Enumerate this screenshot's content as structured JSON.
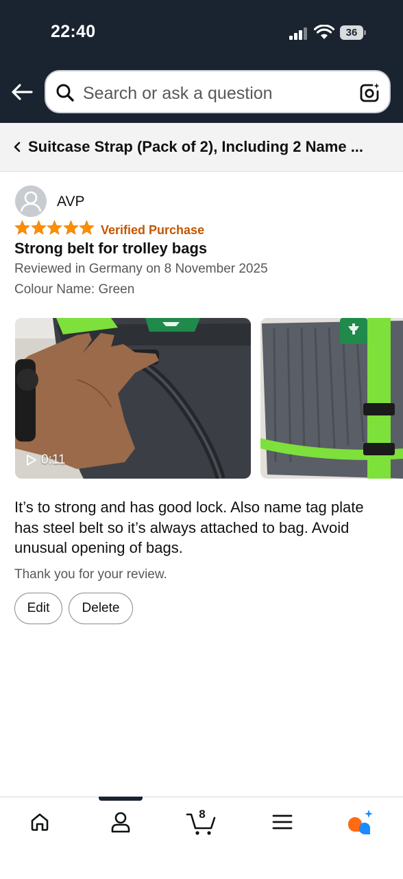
{
  "status_bar": {
    "time": "22:40",
    "battery": "36"
  },
  "search": {
    "placeholder": "Search or ask a question"
  },
  "breadcrumb": {
    "title": "Suitcase Strap (Pack of 2), Including 2 Name ..."
  },
  "review": {
    "reviewer": "AVP",
    "rating": 5,
    "verified_label": "Verified Purchase",
    "title": "Strong belt for trolley bags",
    "meta": "Reviewed in Germany on 8 November 2025",
    "variant": "Colour Name: Green",
    "video_duration": "0:11",
    "body": "It’s to strong and has good lock. Also name tag plate has steel belt so it’s always attached to bag. Avoid unusual opening of bags.",
    "thanks": "Thank you for your review.",
    "edit_label": "Edit",
    "delete_label": "Delete"
  },
  "bottom_nav": {
    "cart_count": "8",
    "items": [
      "home-icon",
      "account-icon",
      "cart-icon",
      "menu-icon",
      "rufus-icon"
    ]
  },
  "colors": {
    "header_bg": "#1a2330",
    "star": "#ff8f00",
    "verified": "#c45500",
    "strap_green": "#7ee03a"
  }
}
